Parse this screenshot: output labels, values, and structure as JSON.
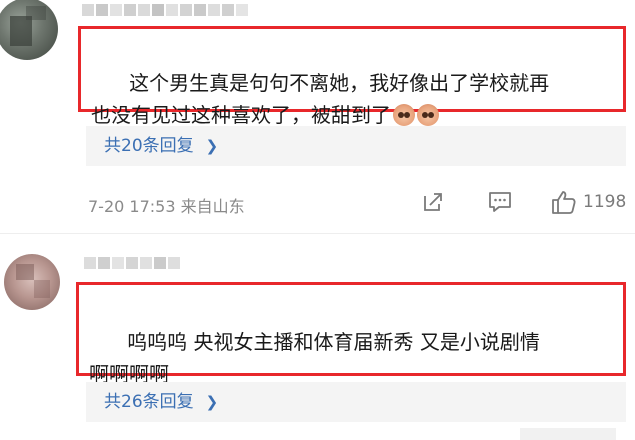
{
  "comments": [
    {
      "text_line1": "这个男生真是句句不离她，我好像出了学校就再",
      "text_line2": "也没有见过这种喜欢了，被甜到了",
      "emoji_icon": "pig-face-emoji",
      "replies_label": "共20条回复",
      "time": "7-20 17:53 来自山东",
      "likes": "1198"
    },
    {
      "text_line1": "呜呜呜 央视女主播和体育届新秀 又是小说剧情",
      "text_line2": "啊啊啊啊",
      "replies_label": "共26条回复"
    }
  ],
  "colors": {
    "highlight_border": "#e8282b",
    "link": "#3b6fb3",
    "meta": "#8a8a8a"
  },
  "icons": [
    "share-icon",
    "comment-icon",
    "like-icon",
    "chevron-right-icon"
  ]
}
